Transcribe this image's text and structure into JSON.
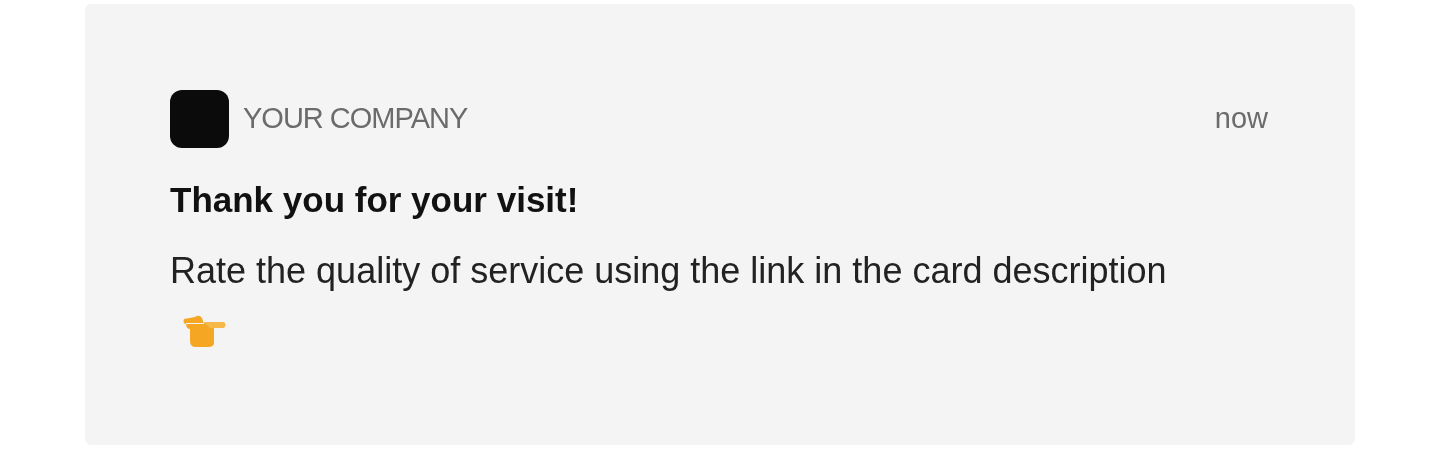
{
  "notification": {
    "app_name": "YOUR COMPANY",
    "time": "now",
    "title": "Thank you for your visit!",
    "body": "Rate the quality of service using the link in the card description"
  }
}
